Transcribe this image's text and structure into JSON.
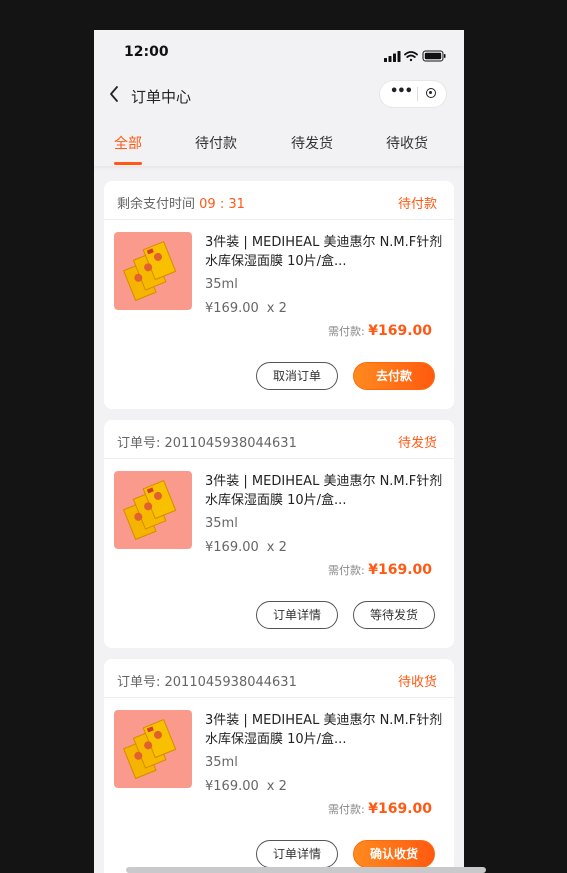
{
  "status_bar": {
    "time": "12:00"
  },
  "nav": {
    "title": "订单中心"
  },
  "tabs": [
    {
      "label": "全部"
    },
    {
      "label": "待付款"
    },
    {
      "label": "待发货"
    },
    {
      "label": "待收货"
    }
  ],
  "orders": [
    {
      "head_prefix": "剩余支付时间",
      "head_time": "09 : 31",
      "status": "待付款",
      "product_name": "3件装 | MEDIHEAL 美迪惠尔 N.M.F针剂水库保湿面膜 10片/盒...",
      "spec": "35ml",
      "price": "¥169.00",
      "qty": "x 2",
      "paid_label": "需付款:",
      "paid_amount": "¥169.00",
      "btn1": "取消订单",
      "btn2": "去付款"
    },
    {
      "head_prefix": "订单号:  2011045938044631",
      "head_time": "",
      "status": "待发货",
      "product_name": "3件装 | MEDIHEAL 美迪惠尔 N.M.F针剂水库保湿面膜 10片/盒...",
      "spec": "35ml",
      "price": "¥169.00",
      "qty": "x 2",
      "paid_label": "需付款:",
      "paid_amount": "¥169.00",
      "btn1": "订单详情",
      "btn2": "等待发货"
    },
    {
      "head_prefix": "订单号:  2011045938044631",
      "head_time": "",
      "status": "待收货",
      "product_name": "3件装 | MEDIHEAL 美迪惠尔 N.M.F针剂水库保湿面膜 10片/盒...",
      "spec": "35ml",
      "price": "¥169.00",
      "qty": "x 2",
      "paid_label": "需付款:",
      "paid_amount": "¥169.00",
      "btn1": "订单详情",
      "btn2": "确认收货"
    }
  ],
  "colors": {
    "accent": "#ff5a14",
    "thumb_bg": "#f99a8c"
  }
}
